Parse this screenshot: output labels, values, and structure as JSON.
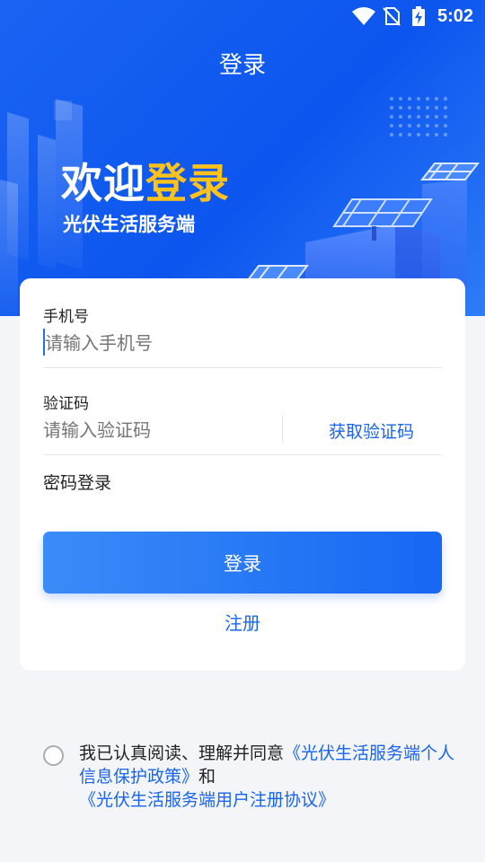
{
  "status_bar": {
    "time": "5:02"
  },
  "nav": {
    "title": "登录"
  },
  "hero": {
    "welcome_prefix": "欢迎",
    "welcome_highlight": "登录",
    "subtitle": "光伏生活服务端"
  },
  "form": {
    "phone_label": "手机号",
    "phone_placeholder": "请输入手机号",
    "code_label": "验证码",
    "code_placeholder": "请输入验证码",
    "get_code_label": "获取验证码",
    "password_login_label": "密码登录",
    "login_button_label": "登录",
    "register_label": "注册"
  },
  "agreement": {
    "prefix": "我已认真阅读、理解并同意",
    "privacy_link": "《光伏生活服务端个人信息保护政策》",
    "conjunction": "和",
    "user_link": "《光伏生活服务端用户注册协议》",
    "checked": false
  },
  "colors": {
    "hero_blue": "#0c56ef",
    "accent_yellow": "#ffc21a",
    "link_blue": "#1a64f0"
  }
}
